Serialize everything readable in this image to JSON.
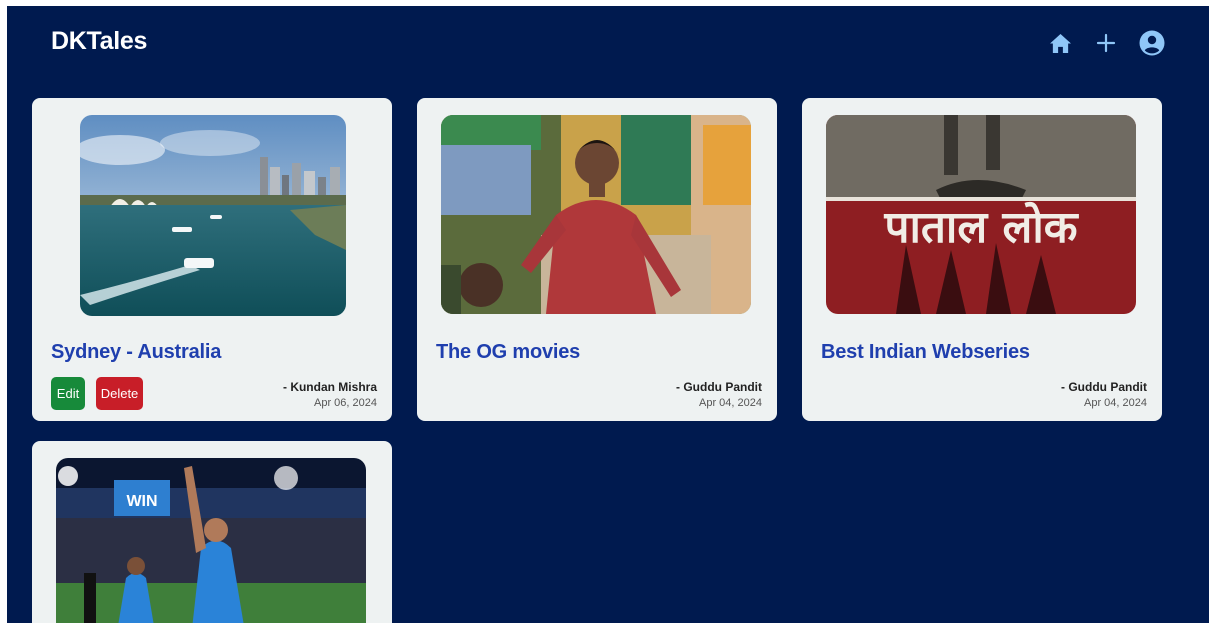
{
  "app": {
    "brand": "DKTales"
  },
  "nav": [
    {
      "name": "home-icon"
    },
    {
      "name": "plus-icon"
    },
    {
      "name": "user-icon"
    }
  ],
  "posts": [
    {
      "title": "Sydney - Australia",
      "author": "- Kundan Mishra",
      "date": "Apr 06, 2024",
      "edit_label": "Edit",
      "delete_label": "Delete"
    },
    {
      "title": "The OG movies",
      "author": "- Guddu Pandit",
      "date": "Apr 04, 2024"
    },
    {
      "title": "Best Indian Webseries",
      "author": "- Guddu Pandit",
      "date": "Apr 04, 2024",
      "image_text": "पाताल लोक"
    },
    {
      "image_text": "WIN"
    }
  ],
  "colors": {
    "background": "#001a4f",
    "card": "#eef2f2",
    "title": "#1f3fae",
    "edit": "#178a3a",
    "delete": "#c81e28",
    "nav_icon": "#8fc6f7"
  }
}
